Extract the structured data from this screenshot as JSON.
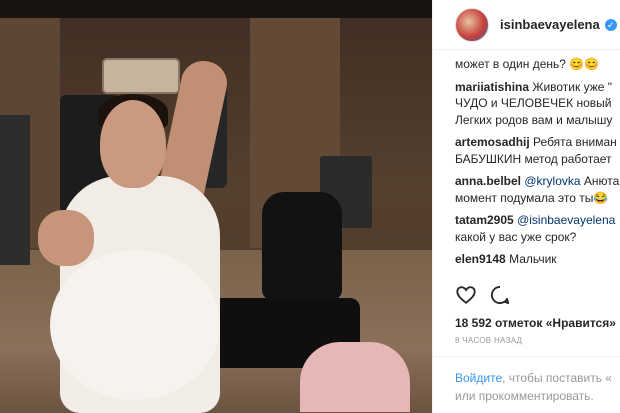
{
  "post": {
    "username": "isinbaevayelena",
    "header_suffix": "•",
    "comments": [
      {
        "user": "",
        "mention": "",
        "lines": [
          "может в один день? 😊😊"
        ]
      },
      {
        "user": "mariiatishina",
        "mention": "",
        "lines": [
          "Животик уже \"",
          "ЧУДО и ЧЕЛОВЕЧЕК новый",
          "Легких родов вам и малышу"
        ]
      },
      {
        "user": "artemosadhij",
        "mention": "",
        "lines": [
          "Ребята вниман",
          "БАБУШКИН метод работает"
        ]
      },
      {
        "user": "anna.belbel",
        "mention": "@krylovka",
        "lines": [
          "Анюта",
          "момент подумала это ты😂"
        ]
      },
      {
        "user": "tatam2905",
        "mention": "@isinbaevayelena",
        "lines": [
          "",
          "какой у вас уже срок?"
        ]
      },
      {
        "user": "elen9148",
        "mention": "",
        "lines": [
          "Мальчик"
        ]
      }
    ],
    "likes_text": "18 592 отметок «Нравится»",
    "time_text": "8 часов назад",
    "footer": {
      "login_link": "Войдите",
      "line1_rest": ", чтобы поставить «",
      "line2": "или прокомментировать."
    }
  },
  "icons": {
    "like": "heart-icon",
    "comment": "comment-icon",
    "verified": "verified-badge-icon"
  },
  "colors": {
    "link": "#3897f0",
    "verified": "#3897f0",
    "text": "#262626",
    "muted": "#999999"
  }
}
